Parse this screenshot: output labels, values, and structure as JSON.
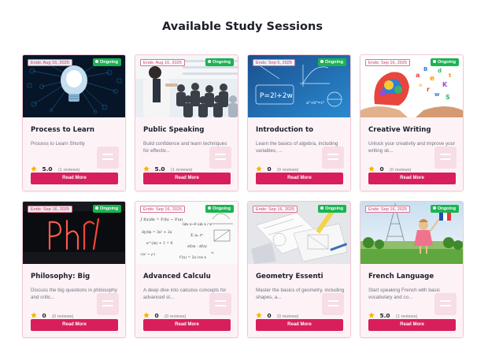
{
  "page": {
    "title": "Available Study Sessions"
  },
  "colors": {
    "accent": "#d81e5b",
    "status_green": "#1cb351",
    "star": "#f5b301",
    "card_border": "#f2c7d4"
  },
  "cards": [
    {
      "image": "lightbulb-network-photo",
      "ends": "Ends: Aug 16, 2025",
      "status": "Ongoing",
      "title": "Process to Learn",
      "description": "Process to Learn Shortly",
      "rating": "5.0",
      "reviews": "(1 reviews)",
      "button": "Read More"
    },
    {
      "image": "public-speaking-audience-photo",
      "ends": "Ends: Aug 16, 2025",
      "status": "Ongoing",
      "title": "Public Speaking",
      "description": "Build confidence and learn techniques for effectiv...",
      "rating": "5.0",
      "reviews": "(1 reviews)",
      "button": "Read More"
    },
    {
      "image": "algebra-chalkboard-photo",
      "ends": "Ends: Sep 5, 2025",
      "status": "Ongoing",
      "title": "Introduction to",
      "description": "Learn the basics of algebra, including variables, ...",
      "rating": "0",
      "reviews": "(0 reviews)",
      "button": "Read More"
    },
    {
      "image": "creative-writing-heads-photo",
      "ends": "Ends: Sep 16, 2025",
      "status": "Ongoing",
      "title": "Creative Writing",
      "description": "Unlock your creativity and improve your writing sk...",
      "rating": "0",
      "reviews": "(0 reviews)",
      "button": "Read More"
    },
    {
      "image": "neon-phd-sign-photo",
      "ends": "Ends: Sep 16, 2025",
      "status": "Ongoing",
      "title": "Philosophy: Big",
      "description": "Discuss the big questions in philosophy and critic...",
      "rating": "0",
      "reviews": "(0 reviews)",
      "button": "Read More"
    },
    {
      "image": "calculus-formulas-sketch",
      "ends": "Ends: Sep 16, 2025",
      "status": "Ongoing",
      "title": "Advanced Calculu",
      "description": "A deep dive into calculus concepts for advanced st...",
      "rating": "0",
      "reviews": "(0 reviews)",
      "button": "Read More"
    },
    {
      "image": "geometry-drafting-photo",
      "ends": "Ends: Sep 16, 2025",
      "status": "Ongoing",
      "title": "Geometry Essenti",
      "description": "Master the basics of geometry, including shapes, a...",
      "rating": "0",
      "reviews": "(0 reviews)",
      "button": "Read More"
    },
    {
      "image": "girl-eiffel-tower-photo",
      "ends": "Ends: Sep 16, 2025",
      "status": "Ongoing",
      "title": "French Language",
      "description": "Start speaking French with basic vocabulary and co...",
      "rating": "5.0",
      "reviews": "(1 reviews)",
      "button": "Read More"
    }
  ]
}
